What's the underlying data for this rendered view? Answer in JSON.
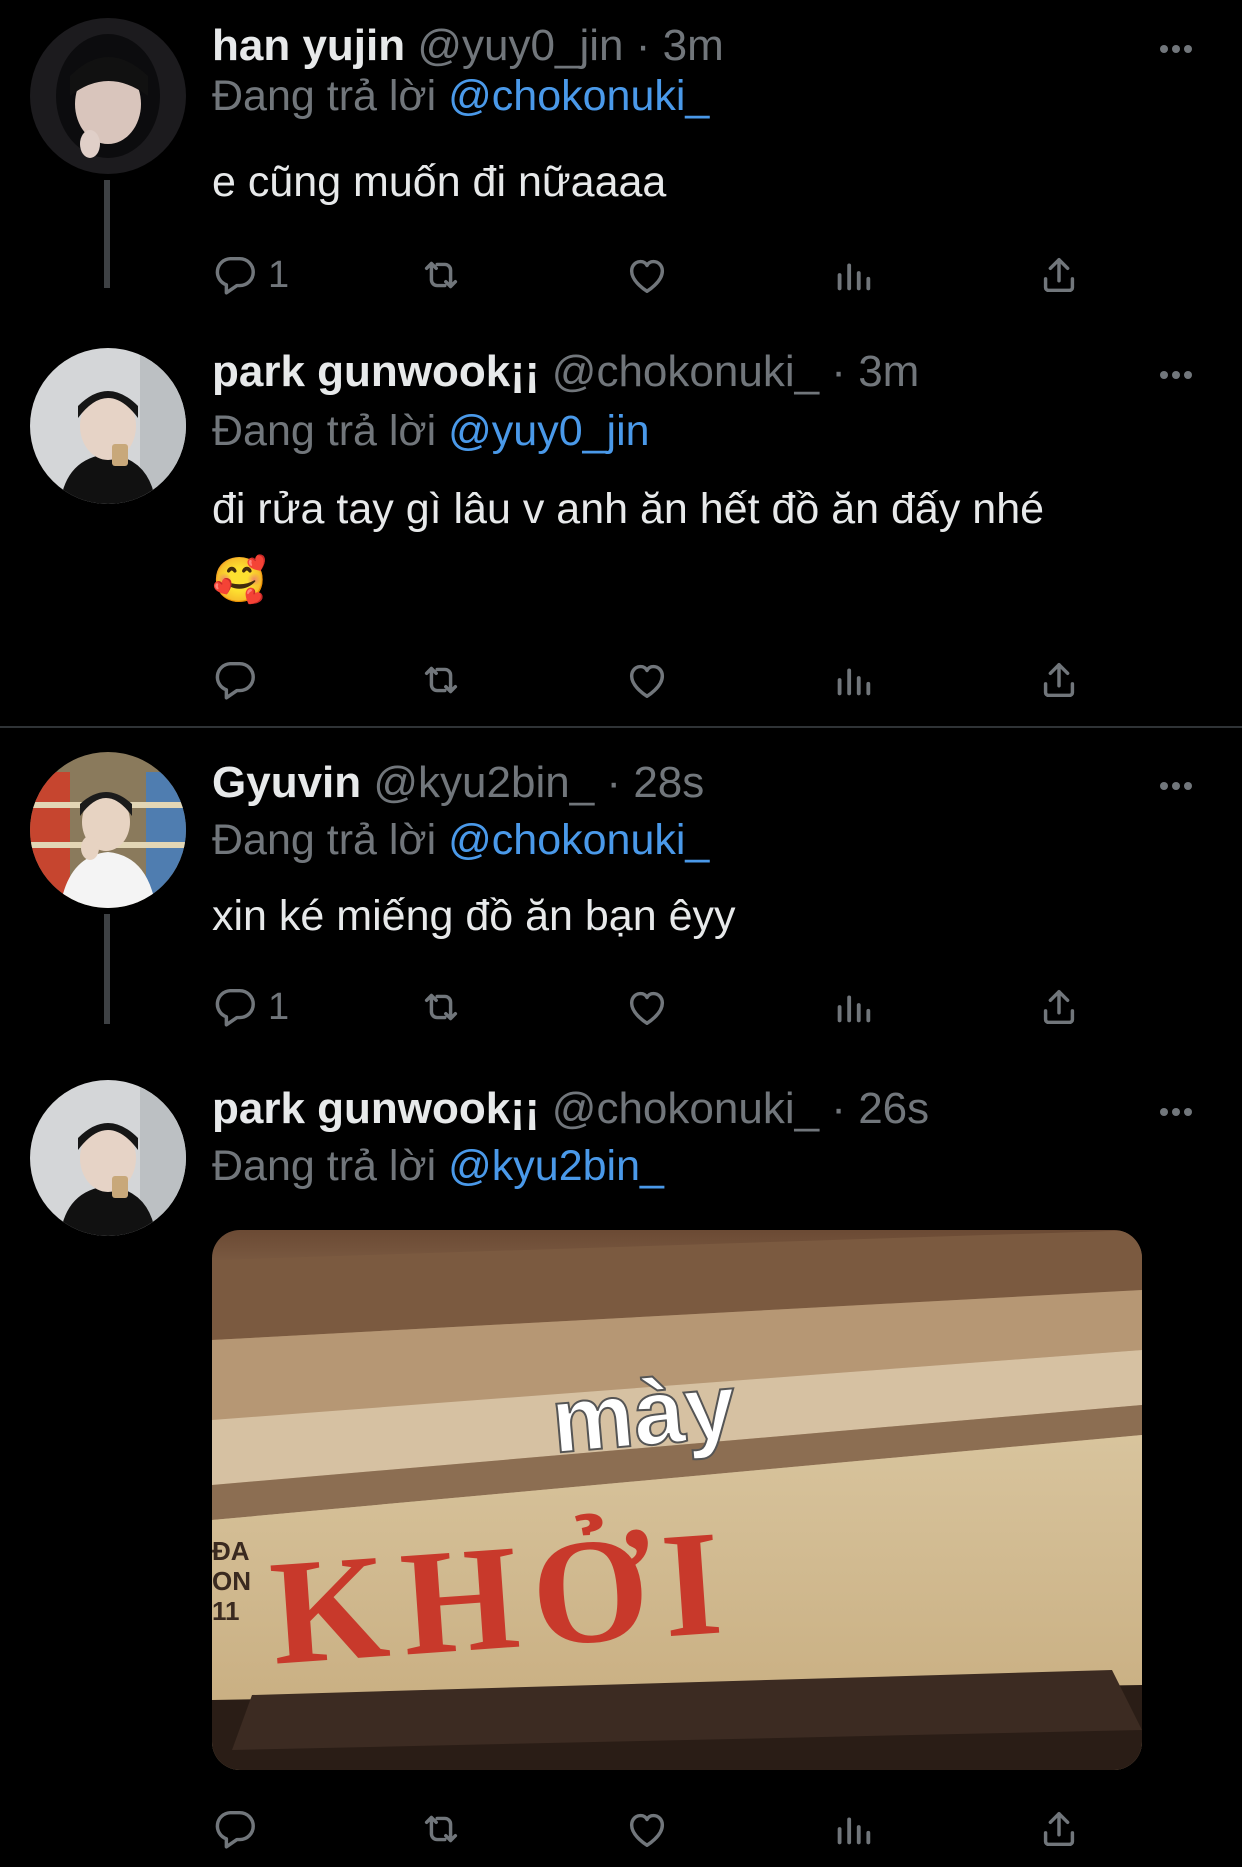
{
  "tweets": [
    {
      "name": "han yujin",
      "handle": "@yuy0_jin",
      "sep": "·",
      "time": "3m",
      "replying_prefix": "Đang trả lời",
      "replying_to": "@chokonuki_",
      "text": "e cũng muốn đi nữaaaa",
      "reply_count": "1"
    },
    {
      "name": "park gunwook¡¡",
      "handle": "@chokonuki_",
      "sep": "·",
      "time": "3m",
      "replying_prefix": "Đang trả lời",
      "replying_to": "@yuy0_jin",
      "text": "đi rửa tay gì lâu v anh ăn hết đồ ăn đấy nhé",
      "emoji": "🥰",
      "reply_count": ""
    },
    {
      "name": "Gyuvin",
      "handle": "@kyu2bin_",
      "sep": "·",
      "time": "28s",
      "replying_prefix": "Đang trả lời",
      "replying_to": "@chokonuki_",
      "text": "xin ké miếng đồ ăn bạn êyy",
      "reply_count": "1"
    },
    {
      "name": "park gunwook¡¡",
      "handle": "@chokonuki_",
      "sep": "·",
      "time": "26s",
      "replying_prefix": "Đang trả lời",
      "replying_to": "@kyu2bin_",
      "media": {
        "caption": "mày",
        "sign_text": "KHỞI",
        "side_text": "ĐA\nON\n11"
      },
      "reply_count": ""
    }
  ],
  "icons": [
    "reply-icon",
    "retweet-icon",
    "like-icon",
    "analytics-icon",
    "share-icon",
    "more-icon"
  ],
  "colors": {
    "background": "#000000",
    "text": "#e7e9ea",
    "muted": "#71767b",
    "mention": "#4a99e9"
  }
}
